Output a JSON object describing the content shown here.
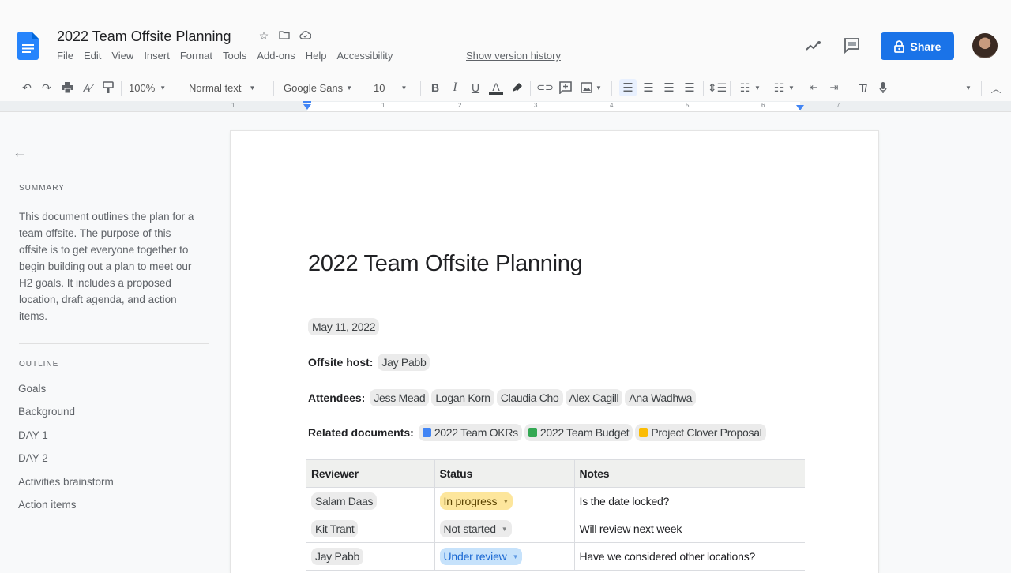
{
  "app": {
    "doc_title": "2022 Team Offsite Planning",
    "menu": [
      "File",
      "Edit",
      "View",
      "Insert",
      "Format",
      "Tools",
      "Add-ons",
      "Help",
      "Accessibility"
    ],
    "version_history": "Show version history",
    "share_label": "Share",
    "accent": "#1a73e8"
  },
  "toolbar": {
    "zoom": "100%",
    "style": "Normal text",
    "font": "Google Sans",
    "size": "10"
  },
  "ruler": {
    "numbers": [
      "1",
      "1",
      "2",
      "3",
      "4",
      "5",
      "6",
      "7"
    ]
  },
  "sidebar": {
    "summary_heading": "SUMMARY",
    "summary_text": "This document outlines the plan for a team offsite. The purpose of this offsite is to get everyone together to begin building out a plan to meet our H2 goals. It includes a proposed location, draft agenda, and action items.",
    "outline_heading": "OUTLINE",
    "outline": [
      "Goals",
      "Background",
      "DAY 1",
      "DAY 2",
      "Activities brainstorm",
      "Action items"
    ]
  },
  "document": {
    "heading": "2022 Team Offsite Planning",
    "date": "May 11, 2022",
    "host_label": "Offsite host:",
    "host": "Jay Pabb",
    "attendees_label": "Attendees:",
    "attendees": [
      "Jess Mead",
      "Logan Korn",
      "Claudia Cho",
      "Alex Cagill",
      "Ana Wadhwa"
    ],
    "related_label": "Related documents:",
    "related": [
      {
        "name": "2022 Team OKRs",
        "type": "docs",
        "color": "#4285f4"
      },
      {
        "name": "2022 Team Budget",
        "type": "sheets",
        "color": "#34a853"
      },
      {
        "name": "Project Clover Proposal",
        "type": "slides",
        "color": "#fbbc04"
      }
    ],
    "table": {
      "headers": [
        "Reviewer",
        "Status",
        "Notes"
      ],
      "rows": [
        {
          "reviewer": "Salam Daas",
          "status": "In progress",
          "status_color": "#fde69c",
          "status_text_color": "#6b4e00",
          "notes": "Is the date locked?"
        },
        {
          "reviewer": "Kit Trant",
          "status": "Not started",
          "status_color": "#ebebeb",
          "status_text_color": "#3c4043",
          "notes": "Will review next week"
        },
        {
          "reviewer": "Jay Pabb",
          "status": "Under review",
          "status_color": "#c6e2fb",
          "status_text_color": "#1967d2",
          "notes": "Have we considered other locations?"
        }
      ]
    }
  }
}
